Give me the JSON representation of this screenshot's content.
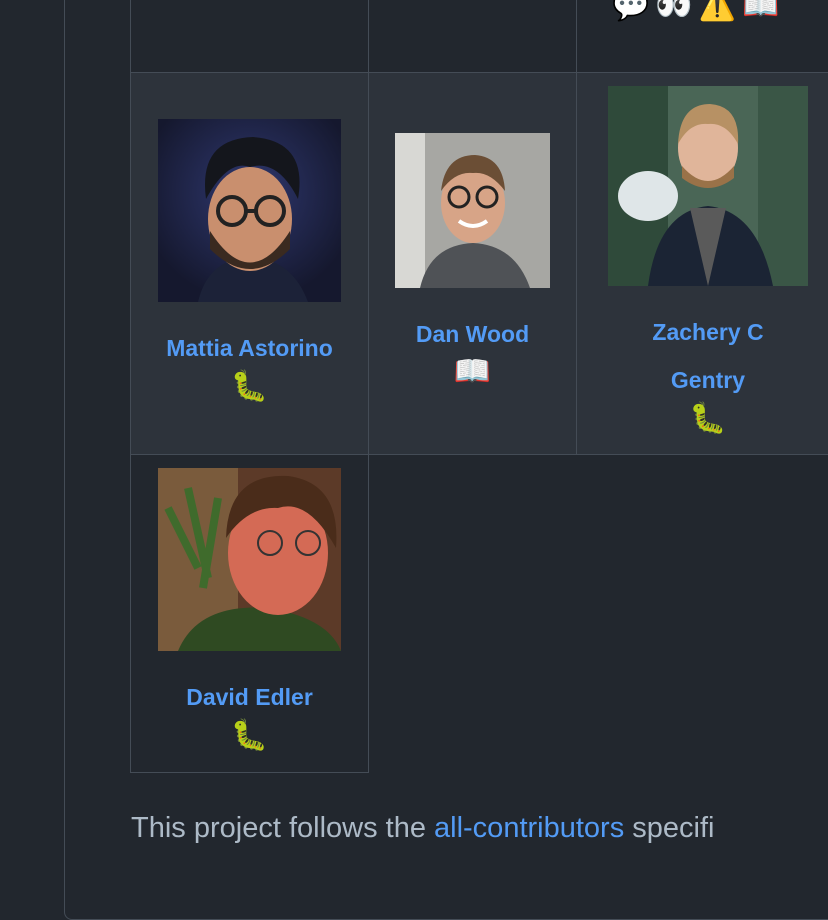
{
  "top_row": {
    "emojis": [
      "💬",
      "👀",
      "⚠️",
      "📖"
    ]
  },
  "contributors": [
    {
      "name": "Mattia Astorino",
      "contribution_emoji": "🐛",
      "contribution_icon": "bug-icon"
    },
    {
      "name": "Dan Wood",
      "contribution_emoji": "📖",
      "contribution_icon": "book-icon"
    },
    {
      "name_line1": "Zachery C",
      "name_line2": "Gentry",
      "contribution_emoji": "🐛",
      "contribution_icon": "bug-icon"
    },
    {
      "name": "David Edler",
      "contribution_emoji": "🐛",
      "contribution_icon": "bug-icon"
    }
  ],
  "footer": {
    "prefix": "This project follows the ",
    "link": "all-contributors",
    "suffix": " specifi"
  },
  "colors": {
    "background": "#22272e",
    "cell_alt": "#2d333b",
    "border": "#444c56",
    "link": "#539bf5",
    "text": "#adbac7"
  }
}
